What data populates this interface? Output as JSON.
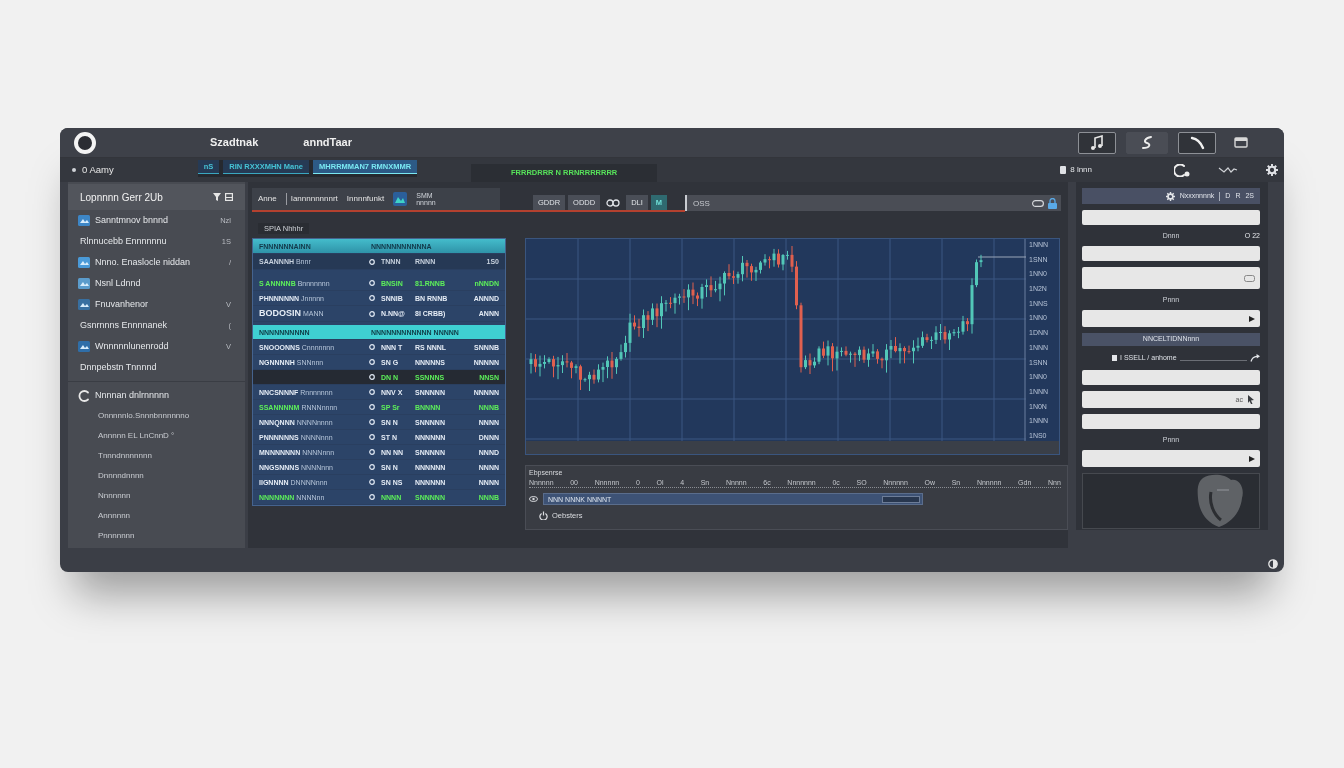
{
  "title_bar": {
    "items": [
      "Szadtnak",
      "anndTaar"
    ]
  },
  "sub_bar": {
    "account": "0 Aamy",
    "tabs": [
      {
        "label": "nS",
        "selected": false
      },
      {
        "label": "RIN RXXXMHN Mane",
        "selected": false
      },
      {
        "label": "MHRRMMAN7 RMNXMMR",
        "selected": true
      }
    ],
    "status": "FRRRDRRR N RRNRRRRRRR",
    "user": "8 lnnn"
  },
  "sidebar": {
    "title": "Lopnnnn Gerr 2Ub",
    "items": [
      {
        "kind": "icon",
        "label": "Sanntmnov bnnnd",
        "meta": "Nzl"
      },
      {
        "kind": "plain",
        "label": "Rlnnucebb Ennnnnnu",
        "meta": "1S"
      },
      {
        "kind": "icon",
        "label": "Nnno. Enaslocle niddan",
        "meta": "/"
      },
      {
        "kind": "icon",
        "label": "Nsnl Ldnnd"
      },
      {
        "kind": "icon",
        "label": "Fnuvanhenor",
        "meta": "V"
      },
      {
        "kind": "plain",
        "label": "Gsnrnnns Ennnnanek",
        "meta": "("
      },
      {
        "kind": "icon",
        "label": "Wnnnnnlunenrodd",
        "meta": "V"
      },
      {
        "kind": "plain",
        "label": "Dnnpebstn Tnnnnd"
      },
      {
        "kind": "group",
        "label": "Nnnnan dnlrnnnnn",
        "children": [
          {
            "label": "Onnnnnlo.Snnnbnnnnnno"
          },
          {
            "label": "Annnnn EL LnCnnD °"
          },
          {
            "label": "Tnnndnnnnnnn"
          },
          {
            "label": "Dnnnndnnnn"
          },
          {
            "label": "Nnnnnnn"
          },
          {
            "label": "Annnnnn"
          },
          {
            "label": "Pnnnnnnn"
          }
        ]
      }
    ]
  },
  "toolbar": {
    "items": [
      "Anne",
      "Iannnnnnnnrt",
      "Innnnfunkt"
    ],
    "badge": [
      "SMM",
      "nnnnn"
    ]
  },
  "segments": [
    {
      "kind": "text",
      "label": "GDDR"
    },
    {
      "kind": "text",
      "label": "ODDD"
    },
    {
      "kind": "icon"
    },
    {
      "kind": "text",
      "label": "DLI"
    },
    {
      "kind": "accent",
      "label": "M"
    }
  ],
  "search": {
    "placeholder": "OSS"
  },
  "section_label": "SPIA Nhhhr",
  "table": {
    "rows": [
      {
        "kind": "header",
        "cells": [
          "FNNNNNNAINN",
          "NNNNNNNNNNNA"
        ]
      },
      {
        "kind": "summary",
        "name": "SAANNNH",
        "detail": "Bnnr",
        "qty": "TNNN",
        "price": "RNNN",
        "change": "1S0",
        "gain": false
      },
      {
        "kind": "row",
        "name": "S ANNNNB",
        "detail": "Bnnnnnnn",
        "qty": "BNSIN",
        "price": "81.RNNB",
        "change": "nNNDN",
        "gain": true
      },
      {
        "kind": "row",
        "name": "PHNNNNNN",
        "detail": "Jnnnnn",
        "qty": "SNNIB",
        "price": "BN RNNB",
        "change": "ANNND",
        "gain": false
      },
      {
        "kind": "emphasis",
        "name": "BODOSIN",
        "detail": "MANN",
        "qty": "N.NN@",
        "price": "8I CRBB)",
        "change": "ANNN",
        "gain": false
      },
      {
        "kind": "group",
        "cells": [
          "NNNNNNNNNN",
          "NNNNNNNNNNNN NNNNN"
        ]
      },
      {
        "kind": "row",
        "name": "SNOOONNS",
        "detail": "Cnnnnnnn",
        "qty": "NNN T",
        "price": "RS NNNL",
        "change": "SNNNB",
        "gain": false
      },
      {
        "kind": "row",
        "name": "NGNNNNH",
        "detail": "SNNnnn",
        "qty": "SN G",
        "price": "NNNNNS",
        "change": "NNNNN",
        "gain": false
      },
      {
        "kind": "total",
        "name": "",
        "detail": "",
        "qty": "DN N",
        "price": "SSNNNS",
        "change": "NNSN",
        "gain": true
      },
      {
        "kind": "row",
        "name": "NNCSNNNF",
        "detail": "Rnnnnnnn",
        "qty": "NNV X",
        "price": "SNNNNN",
        "change": "NNNNN",
        "gain": false
      },
      {
        "kind": "row",
        "name": "SSANNNNM",
        "detail": "RNNNnnnn",
        "qty": "SP Sr",
        "price": "BNNNN",
        "change": "NNNB",
        "gain": true
      },
      {
        "kind": "row",
        "name": "NNNQNNN",
        "detail": "NNNNnnnn",
        "qty": "SN N",
        "price": "SNNNNN",
        "change": "NNNN",
        "gain": false
      },
      {
        "kind": "row",
        "name": "PNNNNNNS",
        "detail": "NNNNnnn",
        "qty": "ST N",
        "price": "NNNNNN",
        "change": "DNNN",
        "gain": false
      },
      {
        "kind": "row",
        "name": "MNNNNNNN",
        "detail": "NNNNnnn",
        "qty": "NN NN",
        "price": "SNNNNN",
        "change": "NNND",
        "gain": false
      },
      {
        "kind": "row",
        "name": "NNGSNNNS",
        "detail": "NNNNnnn",
        "qty": "SN N",
        "price": "NNNNNN",
        "change": "NNNN",
        "gain": false
      },
      {
        "kind": "row",
        "name": "IIGNNNN",
        "detail": "DNNNNnnn",
        "qty": "SN NS",
        "price": "NNNNNN",
        "change": "NNNN",
        "gain": false
      },
      {
        "kind": "row",
        "name": "NNNNNNN",
        "detail": "NNNNnn",
        "qty": "NNNN",
        "price": "SNNNNN",
        "change": "NNNB",
        "gain": true
      }
    ]
  },
  "chart": {
    "axis_labels": [
      "1NNN",
      "1SNN",
      "1NN0",
      "1N2N",
      "1NNS",
      "1NN0",
      "1DNN",
      "1NNN",
      "1SNN",
      "1NN0",
      "1NNN",
      "1N0N",
      "1NNN",
      "1NS0"
    ]
  },
  "timeline": {
    "title": "Ebpsenrse",
    "ticks": [
      "Nnnnnn",
      "00",
      "Nnnnnn",
      "0",
      "Ol",
      "4",
      "Sn",
      "Nnnnn",
      "6c",
      "Nnnnnnn",
      "0c",
      "SO",
      "Nnnnnn",
      "Ow",
      "Sn",
      "Nnnnnn",
      "Gdn",
      "Nnn"
    ],
    "bar_text": "NNN NNNK NNNNT",
    "action": "Oebsters"
  },
  "form": {
    "rows": [
      {
        "kind": "header",
        "text": "Nxxxnnnnk",
        "tags": [
          "D",
          "R",
          "2S"
        ]
      },
      {
        "kind": "input"
      },
      {
        "kind": "label",
        "text": "Dnnn",
        "aside": "O 22"
      },
      {
        "kind": "input"
      },
      {
        "kind": "input-tall"
      },
      {
        "kind": "label",
        "text": "Pnnn"
      },
      {
        "kind": "select"
      },
      {
        "kind": "banner",
        "text": "NNCELTIDNNnnn"
      },
      {
        "kind": "caption",
        "text": "I SSELL / anhome"
      },
      {
        "kind": "input"
      },
      {
        "kind": "input-icon",
        "suffix": "ac"
      },
      {
        "kind": "input"
      },
      {
        "kind": "label",
        "text": "Pnnn"
      },
      {
        "kind": "select"
      },
      {
        "kind": "emblem"
      }
    ]
  }
}
